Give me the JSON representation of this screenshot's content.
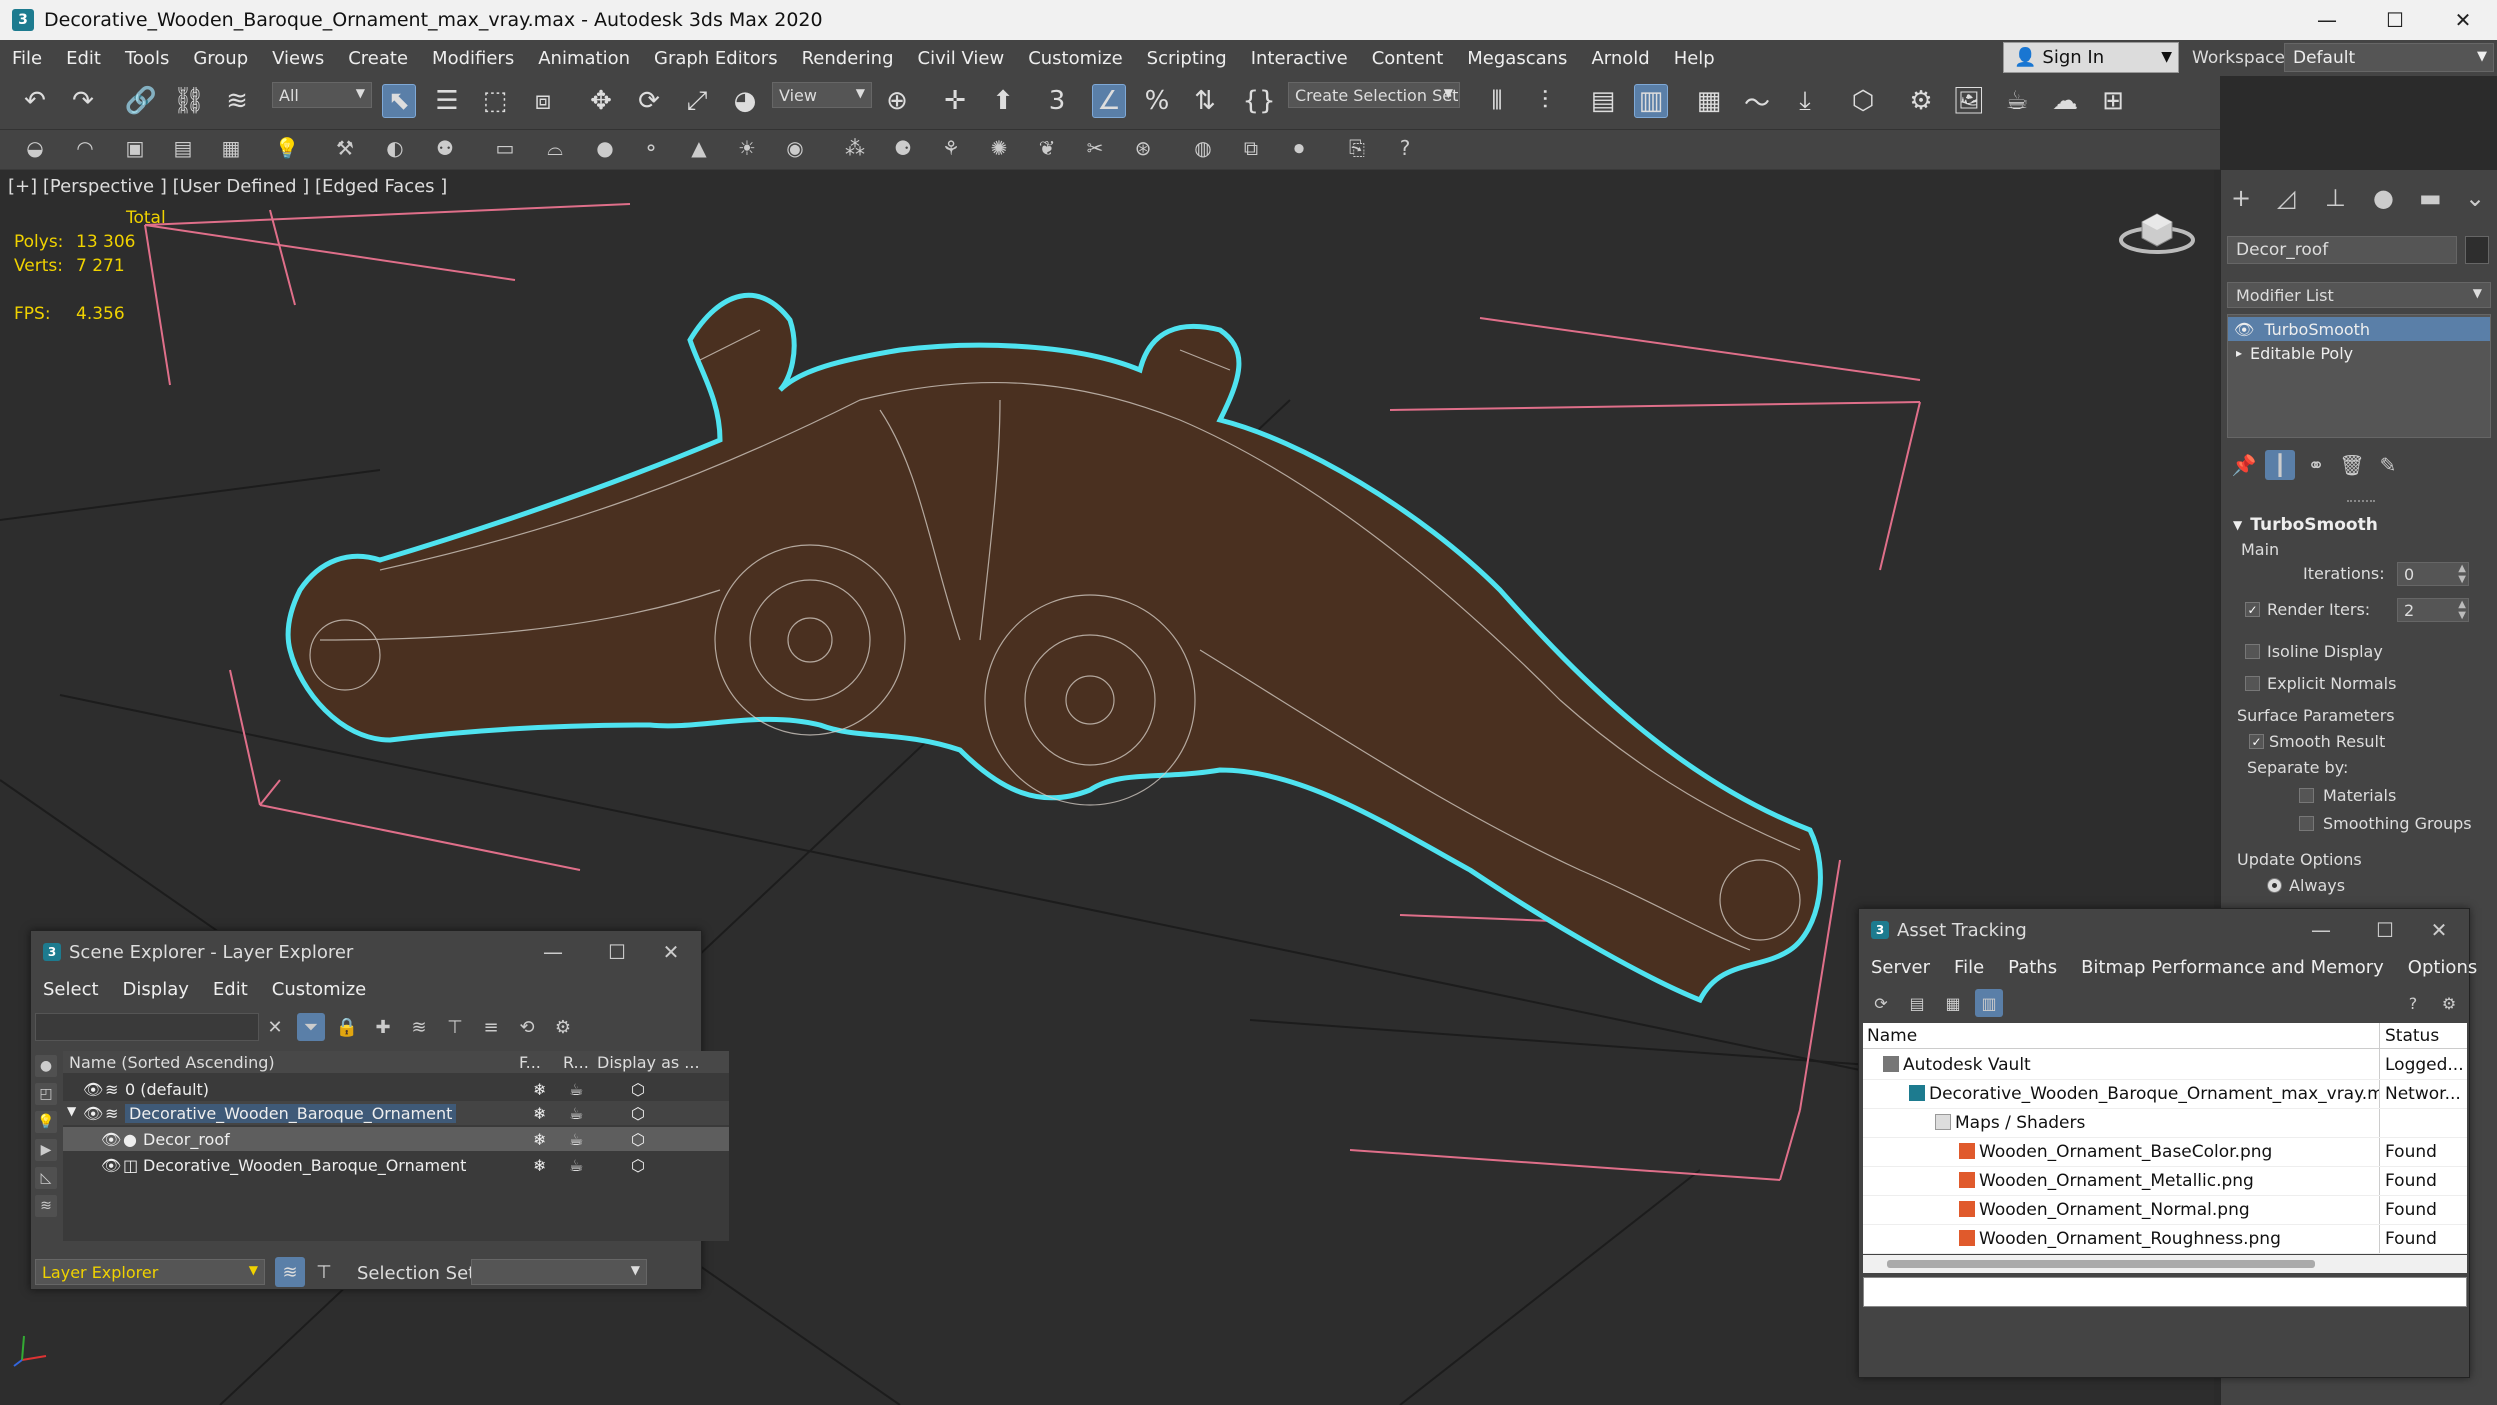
{
  "window": {
    "title": "Decorative_Wooden_Baroque_Ornament_max_vray.max - Autodesk 3ds Max 2020",
    "app_icon": "3",
    "minimize": "—",
    "maximize": "☐",
    "close": "✕"
  },
  "menu": [
    "File",
    "Edit",
    "Tools",
    "Group",
    "Views",
    "Create",
    "Modifiers",
    "Animation",
    "Graph Editors",
    "Rendering",
    "Civil View",
    "Customize",
    "Scripting",
    "Interactive",
    "Content",
    "Megascans",
    "Arnold",
    "Help"
  ],
  "account": {
    "sign_in": "Sign In",
    "workspaces_label": "Workspaces:",
    "workspace": "Default"
  },
  "toolbar": {
    "filter": "All",
    "ref_coord": "View",
    "selection_set": "Create Selection Set",
    "snap_label": "3"
  },
  "viewport": {
    "label": "[+] [Perspective ] [User Defined ] [Edged Faces ]",
    "stats": {
      "total_label": "Total",
      "polys_label": "Polys:",
      "polys": "13 306",
      "verts_label": "Verts:",
      "verts": "7 271",
      "fps_label": "FPS:",
      "fps": "4.356"
    },
    "selection_color": "#4fe3f0",
    "bbox_color": "#e06f8a"
  },
  "command_panel": {
    "object_name": "Decor_roof",
    "modifier_list": "Modifier List",
    "stack": [
      "TurboSmooth",
      "Editable Poly"
    ],
    "rollout_title": "TurboSmooth",
    "main_label": "Main",
    "iterations_label": "Iterations:",
    "iterations": "0",
    "render_iters_label": "Render Iters:",
    "render_iters": "2",
    "isoline": "Isoline Display",
    "explicit_normals": "Explicit Normals",
    "surface_params": "Surface Parameters",
    "smooth_result": "Smooth Result",
    "separate_by": "Separate by:",
    "materials": "Materials",
    "smoothing_groups": "Smoothing Groups",
    "update_options": "Update Options",
    "always": "Always"
  },
  "scene_explorer": {
    "title": "Scene Explorer - Layer Explorer",
    "menu": [
      "Select",
      "Display",
      "Edit",
      "Customize"
    ],
    "columns": [
      "Name (Sorted Ascending)",
      "F...",
      "R...",
      "Display as ..."
    ],
    "rows": [
      {
        "name": "0 (default)"
      },
      {
        "name": "Decorative_Wooden_Baroque_Ornament"
      },
      {
        "name": "Decor_roof"
      },
      {
        "name": "Decorative_Wooden_Baroque_Ornament"
      }
    ],
    "explorer_dropdown": "Layer Explorer",
    "selection_set_label": "Selection Set:"
  },
  "asset_tracking": {
    "title": "Asset Tracking",
    "menu": [
      "Server",
      "File",
      "Paths",
      "Bitmap Performance and Memory",
      "Options"
    ],
    "columns": [
      "Name",
      "Status"
    ],
    "rows": [
      {
        "name": "Autodesk Vault",
        "status": "Logged..."
      },
      {
        "name": "Decorative_Wooden_Baroque_Ornament_max_vray.max",
        "status": "Networ..."
      },
      {
        "name": "Maps / Shaders",
        "status": ""
      },
      {
        "name": "Wooden_Ornament_BaseColor.png",
        "status": "Found"
      },
      {
        "name": "Wooden_Ornament_Metallic.png",
        "status": "Found"
      },
      {
        "name": "Wooden_Ornament_Normal.png",
        "status": "Found"
      },
      {
        "name": "Wooden_Ornament_Roughness.png",
        "status": "Found"
      }
    ]
  }
}
